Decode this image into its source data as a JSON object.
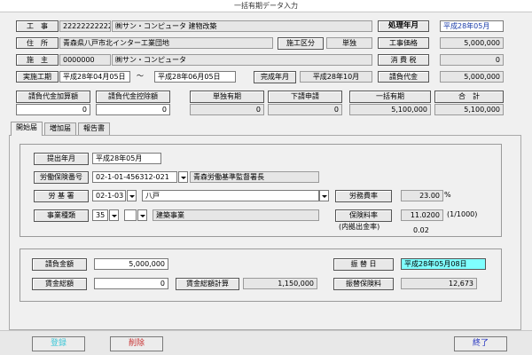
{
  "window": {
    "title": "一括有期データ入力"
  },
  "header": {
    "project_label": "工　事",
    "project_code": "22222222222",
    "project_name": "㈱サン・コンピュータ 建物改築",
    "period_label": "処理年月",
    "period_value": "平成28年05月",
    "address_label": "住　所",
    "address_value": "青森県八戸市北インター工業団地",
    "category_button": "施工区分",
    "category_value": "単独",
    "work_price_label": "工事価格",
    "work_price_value": "5,000,000",
    "owner_label": "施　主",
    "owner_code": "0000000",
    "owner_name": "㈱サン・コンピュータ",
    "tax_label": "消 費 税",
    "tax_value": "0",
    "exec_period_label": "実施工期",
    "start_date": "平成28年04月05日",
    "tilde": "〜",
    "end_date": "平成28年06月05日",
    "completion_label": "完成年月",
    "completion_value": "平成28年10月",
    "contract_label": "請負代金",
    "contract_value": "5,000,000"
  },
  "summary": {
    "add_label": "請負代金加算額",
    "add_value": "0",
    "deduct_label": "請負代金控除額",
    "deduct_value": "0",
    "single_label": "単独有期",
    "single_value": "0",
    "sub_label": "下請申請",
    "sub_value": "0",
    "bulk_label": "一括有期",
    "bulk_value": "5,100,000",
    "total_label": "合　計",
    "total_value": "5,100,000"
  },
  "tabs": [
    {
      "label": "開始届"
    },
    {
      "label": "増加届"
    },
    {
      "label": "報告書"
    }
  ],
  "form": {
    "submit_label": "提出年月",
    "submit_value": "平成28年05月",
    "insurance_no_label": "労働保険番号",
    "insurance_no_value": "02-1-01-456312-021",
    "insurance_office": "青森労働基準監督署長",
    "labor_office_label": "労 基 署",
    "labor_office_code": "02-1-03",
    "labor_office_name": "八戸",
    "cost_rate_label": "労務費率",
    "cost_rate_value": "23.00",
    "percent": "%",
    "business_type_label": "事業種類",
    "business_code1": "35",
    "business_code2": "",
    "business_name": "建築事業",
    "insurance_rate_label": "保険料率",
    "insurance_rate_value": "11.0200",
    "insurance_rate_unit": "(1/1000)",
    "inner_rate_label": "(内拠出金率)",
    "inner_rate_value": "0.02"
  },
  "calc": {
    "contract_amount_label": "請負金額",
    "contract_amount_value": "5,000,000",
    "transfer_date_label": "振 替 日",
    "transfer_date_value": "平成28年05月08日",
    "total_wage_label": "賃金総額",
    "total_wage_value": "0",
    "total_wage_calc_label": "賃金総額計算",
    "total_wage_calc_value": "1,150,000",
    "transfer_fee_label": "振替保険料",
    "transfer_fee_value": "12,673"
  },
  "footer": {
    "register_label": "登録",
    "delete_label": "削除",
    "exit_label": "終了"
  },
  "colors": {
    "background": "#f0f0f0",
    "highlight": "#7fffff",
    "register_text": "#40c8d8",
    "delete_text": "#c83232",
    "exit_text": "#2030c0"
  }
}
